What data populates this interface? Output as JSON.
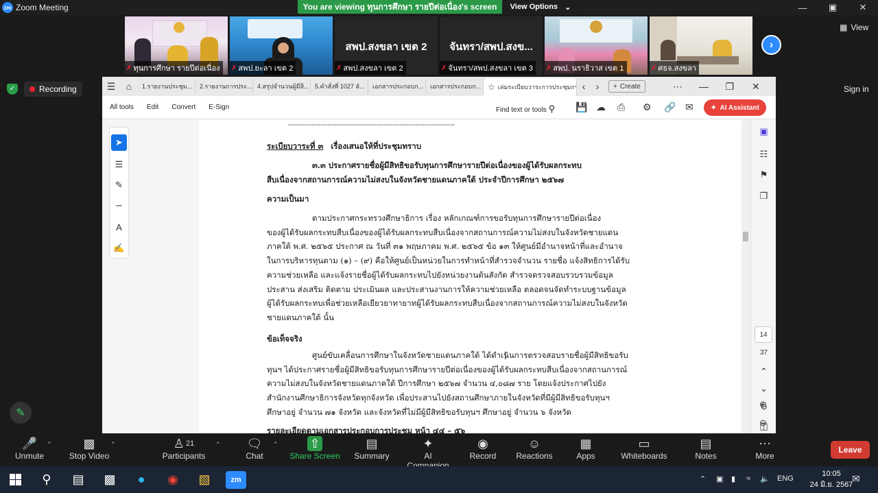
{
  "window": {
    "title": "Zoom Meeting",
    "logo": "zm"
  },
  "banner": {
    "text": "You are viewing ทุนการศึกษา รายปีต่อเนื่อง's screen",
    "options": "View Options"
  },
  "gallery": {
    "tiles": [
      {
        "label": "ทุนการศึกษา รายปีต่อเนื่อง",
        "type": "video"
      },
      {
        "label": "สพป.ยะลา เขต 2",
        "type": "video"
      },
      {
        "label": "สพป.สงขลา เขต 2",
        "name": "สพป.สงขลา เขต 2",
        "type": "name"
      },
      {
        "label": "จันทรา/สพป.สงขลา เขต 3",
        "name": "จันทรา/สพป.สงข...",
        "type": "name"
      },
      {
        "label": "สพป. นราธิวาส เขต 1",
        "type": "video"
      },
      {
        "label": "ศธจ.สงขลา",
        "type": "video"
      }
    ],
    "view_label": "View"
  },
  "status": {
    "recording": "Recording",
    "signin": "Sign in"
  },
  "acrobat": {
    "tabs": [
      "1.รายงานประชุม...",
      "2.รายงานการประ...",
      "4.สรุปจำนวนผู้มีสิ...",
      "5.คำสั่งที่ 1027 ลั...",
      "เอกสารประกอบก...",
      "เอกสารประกอบก...",
      "เล่มระเบียบวาระการประชุมกรรมการ 3..."
    ],
    "create": "Create",
    "menus": [
      "All tools",
      "Edit",
      "Convert",
      "E-Sign"
    ],
    "find": "Find text or tools",
    "ai": "AI Assistant",
    "page_current": "14",
    "page_total": "37"
  },
  "document": {
    "divider": "------------------------------------------------------------------------",
    "agenda": "ระเบียบวาระที่ ๓",
    "agenda_title": "เรื่องเสนอให้ที่ประชุมทราบ",
    "heading1": "๓.๓ ประกาศรายชื่อผู้มีสิทธิขอรับทุนการศึกษารายปีต่อเนื่องของผู้ได้รับผลกระทบ",
    "heading2": "สืบเนื่องจากสถานการณ์ความไม่สงบในจังหวัดชายแดนภาคใต้ ประจำปีการศึกษา ๒๕๖๗",
    "sec1": "ความเป็นมา",
    "p1": [
      "ตามประกาศกระทรวงศึกษาธิการ เรื่อง หลักเกณฑ์การขอรับทุนการศึกษารายปีต่อเนื่อง",
      "ของผู้ได้รับผลกระทบสืบเนื่องของผู้ได้รับผลกระทบสืบเนื่องจากสถานการณ์ความไม่สงบในจังหวัดชายแดน",
      "ภาคใต้ พ.ศ. ๒๕๖๕ ประกาศ ณ วันที่ ๓๑ พฤษภาคม พ.ศ. ๒๕๖๕ ข้อ ๑๓ ให้ศูนย์มีอำนาจหน้าที่และอำนาจ",
      "ในการบริหารทุนตาม (๑) – (๙) คือให้ศูนย์เป็นหน่วยในการทำหน้าที่สำรวจจำนวน รายชื่อ แจ้งสิทธิการได้รับ",
      "ความช่วยเหลือ และแจ้งรายชื่อผู้ได้รับผลกระทบไปยังหน่วยงานต้นสังกัด สำรวจตรวจสอบรวบรวมข้อมูล",
      "ประสาน ส่งเสริม ติดตาม ประเมินผล และประสานงานการให้ความช่วยเหลือ ตลอดจนจัดทำระบบฐานข้อมูล",
      "ผู้ได้รับผลกระทบเพื่อช่วยเหลือเยียวยาทายาทผู้ได้รับผลกระทบสืบเนื่องจากสถานการณ์ความไม่สงบในจังหวัด",
      "ชายแดนภาคใต้ นั้น"
    ],
    "sec2": "ข้อเท็จจริง",
    "p2": [
      "ศูนย์ขับเคลื่อนการศึกษาในจังหวัดชายแดนภาคใต้ ได้ดำเนินการตรวจสอบรายชื่อผู้มีสิทธิขอรับ",
      "ทุนฯ ได้ประกาศรายชื่อผู้มีสิทธิขอรับทุนการศึกษารายปีต่อเนื่องของผู้ได้รับผลกระทบสืบเนื่องจากสถานการณ์",
      "ความไม่สงบในจังหวัดชายแดนภาคใต้ ปีการศึกษา ๒๕๖๗ จำนวน ๔,๐๘๗ ราย โดยแจ้งประกาศไปยัง",
      "สำนักงานศึกษาธิการจังหวัดทุกจังหวัด เพื่อประสานไปยังสถานศึกษาภายในจังหวัดที่มีผู้มีสิทธิขอรับทุนฯ",
      "ศึกษาอยู่ จำนวน ๗๑ จังหวัด และจังหวัดที่ไม่มีผู้มีสิทธิขอรับทุนฯ ศึกษาอยู่ จำนวน ๖ จังหวัด"
    ],
    "cutoff": "รายละเอียดตามเอกสารประกอบการประชุม หน้า ๔๔ – ๕๖"
  },
  "controls": [
    {
      "label": "Unmute",
      "icon": "mic-off-icon"
    },
    {
      "label": "Stop Video",
      "icon": "video-icon"
    },
    {
      "label": "Participants",
      "icon": "participants-icon",
      "count": "21"
    },
    {
      "label": "Chat",
      "icon": "chat-icon"
    },
    {
      "label": "Share Screen",
      "icon": "share-screen-icon"
    },
    {
      "label": "Summary",
      "icon": "summary-icon"
    },
    {
      "label": "AI Companion",
      "icon": "ai-companion-icon"
    },
    {
      "label": "Record",
      "icon": "record-icon"
    },
    {
      "label": "Reactions",
      "icon": "reactions-icon"
    },
    {
      "label": "Apps",
      "icon": "apps-icon"
    },
    {
      "label": "Whiteboards",
      "icon": "whiteboards-icon"
    },
    {
      "label": "Notes",
      "icon": "notes-icon"
    },
    {
      "label": "More",
      "icon": "more-icon"
    }
  ],
  "leave": "Leave",
  "taskbar": {
    "lang": "ENG",
    "time": "10:05",
    "date": "24 มิ.ย. 2567"
  },
  "colors": {
    "share_green": "#2b9a48",
    "zoom_blue": "#2d8cff",
    "leave_red": "#d23b32",
    "ai_red": "#e8423a"
  }
}
